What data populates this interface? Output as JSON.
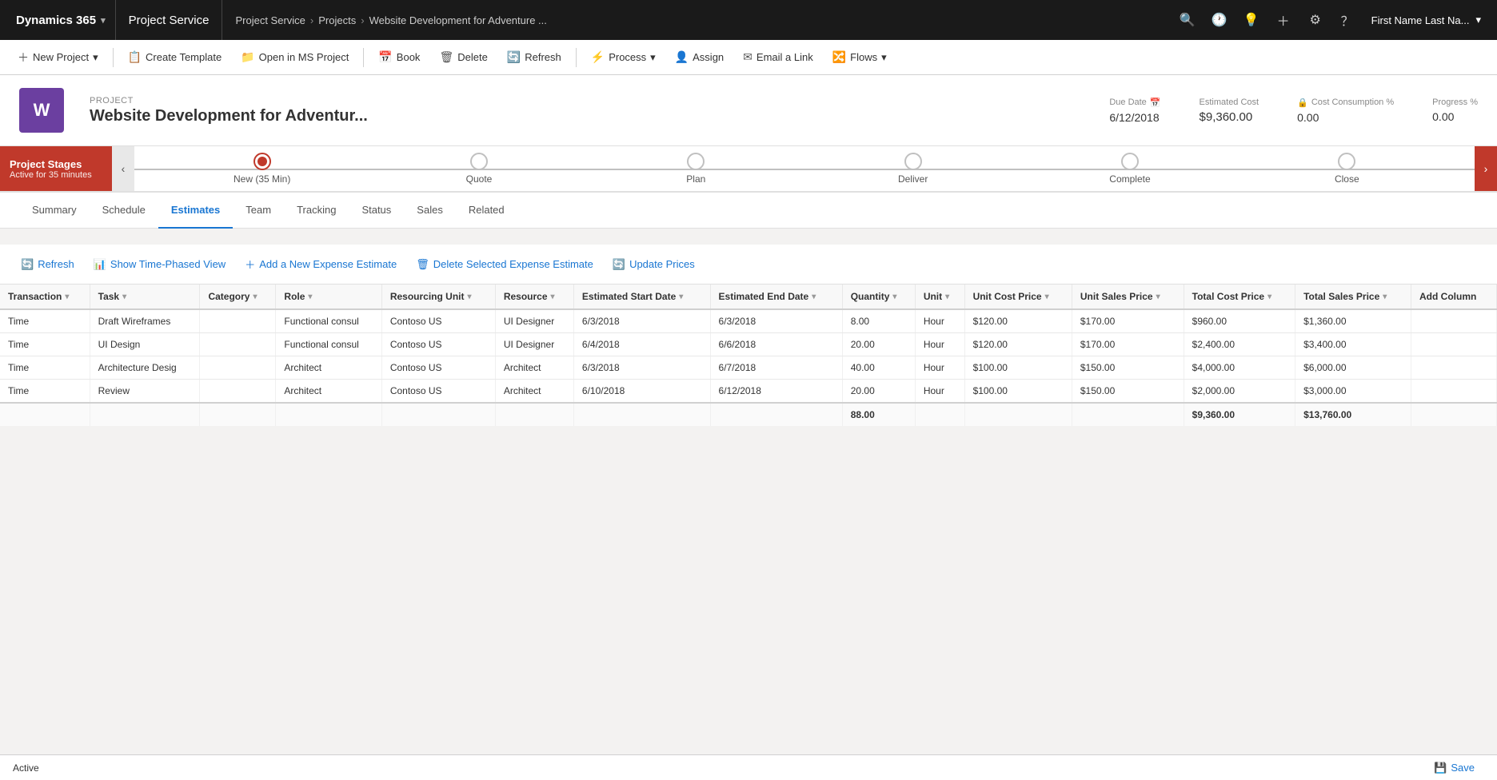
{
  "app": {
    "brand": "Dynamics 365",
    "module": "Project Service",
    "breadcrumb": [
      "Project Service",
      "Projects",
      "Website Development for Adventure ..."
    ]
  },
  "topnav": {
    "icons": [
      "🔍",
      "🕐",
      "💡",
      "＋",
      "⚙",
      "？"
    ],
    "user": "First Name Last Na..."
  },
  "commandbar": {
    "buttons": [
      {
        "id": "new-project",
        "label": "New Project",
        "icon": "＋",
        "has_dropdown": true
      },
      {
        "id": "create-template",
        "label": "Create Template",
        "icon": "📋",
        "has_dropdown": false
      },
      {
        "id": "open-ms-project",
        "label": "Open in MS Project",
        "icon": "📁",
        "has_dropdown": false
      },
      {
        "id": "book",
        "label": "Book",
        "icon": "📅",
        "has_dropdown": false
      },
      {
        "id": "delete",
        "label": "Delete",
        "icon": "🗑",
        "has_dropdown": false
      },
      {
        "id": "refresh",
        "label": "Refresh",
        "icon": "🔄",
        "has_dropdown": false
      },
      {
        "id": "process",
        "label": "Process",
        "icon": "⚡",
        "has_dropdown": true
      },
      {
        "id": "assign",
        "label": "Assign",
        "icon": "👤",
        "has_dropdown": false
      },
      {
        "id": "email-link",
        "label": "Email a Link",
        "icon": "✉",
        "has_dropdown": false
      },
      {
        "id": "flows",
        "label": "Flows",
        "icon": "🔀",
        "has_dropdown": true
      }
    ]
  },
  "project": {
    "label": "PROJECT",
    "title": "Website Development for Adventur...",
    "logo_letter": "W",
    "fields": {
      "due_date_label": "Due Date",
      "due_date_value": "6/12/2018",
      "estimated_cost_label": "Estimated Cost",
      "estimated_cost_value": "$9,360.00",
      "cost_consumption_label": "Cost Consumption %",
      "cost_consumption_value": "0.00",
      "progress_label": "Progress %",
      "progress_value": "0.00"
    }
  },
  "stage_bar": {
    "label": "Project Stages",
    "sublabel": "Active for 35 minutes",
    "stages": [
      {
        "name": "New (35 Min)",
        "active": true
      },
      {
        "name": "Quote",
        "active": false
      },
      {
        "name": "Plan",
        "active": false
      },
      {
        "name": "Deliver",
        "active": false
      },
      {
        "name": "Complete",
        "active": false
      },
      {
        "name": "Close",
        "active": false
      }
    ]
  },
  "tabs": {
    "items": [
      {
        "id": "summary",
        "label": "Summary",
        "active": false
      },
      {
        "id": "schedule",
        "label": "Schedule",
        "active": false
      },
      {
        "id": "estimates",
        "label": "Estimates",
        "active": true
      },
      {
        "id": "team",
        "label": "Team",
        "active": false
      },
      {
        "id": "tracking",
        "label": "Tracking",
        "active": false
      },
      {
        "id": "status",
        "label": "Status",
        "active": false
      },
      {
        "id": "sales",
        "label": "Sales",
        "active": false
      },
      {
        "id": "related",
        "label": "Related",
        "active": false
      }
    ]
  },
  "estimates": {
    "toolbar": {
      "refresh_label": "Refresh",
      "time_phased_label": "Show Time-Phased View",
      "add_expense_label": "Add a New Expense Estimate",
      "delete_expense_label": "Delete Selected Expense Estimate",
      "update_prices_label": "Update Prices"
    },
    "columns": [
      {
        "id": "transaction",
        "label": "Transaction"
      },
      {
        "id": "task",
        "label": "Task"
      },
      {
        "id": "category",
        "label": "Category"
      },
      {
        "id": "role",
        "label": "Role"
      },
      {
        "id": "resourcing_unit",
        "label": "Resourcing Unit"
      },
      {
        "id": "resource",
        "label": "Resource"
      },
      {
        "id": "start_date",
        "label": "Estimated Start Date"
      },
      {
        "id": "end_date",
        "label": "Estimated End Date"
      },
      {
        "id": "quantity",
        "label": "Quantity"
      },
      {
        "id": "unit",
        "label": "Unit"
      },
      {
        "id": "unit_cost_price",
        "label": "Unit Cost Price"
      },
      {
        "id": "unit_sales_price",
        "label": "Unit Sales Price"
      },
      {
        "id": "total_cost_price",
        "label": "Total Cost Price"
      },
      {
        "id": "total_sales_price",
        "label": "Total Sales Price"
      },
      {
        "id": "add_column",
        "label": "Add Column"
      }
    ],
    "rows": [
      {
        "transaction": "Time",
        "task": "Draft Wireframes",
        "category": "",
        "role": "Functional consul",
        "resourcing_unit": "Contoso US",
        "resource": "UI Designer",
        "start_date": "6/3/2018",
        "end_date": "6/3/2018",
        "quantity": "8.00",
        "unit": "Hour",
        "unit_cost_price": "$120.00",
        "unit_sales_price": "$170.00",
        "total_cost_price": "$960.00",
        "total_sales_price": "$1,360.00"
      },
      {
        "transaction": "Time",
        "task": "UI Design",
        "category": "",
        "role": "Functional consul",
        "resourcing_unit": "Contoso US",
        "resource": "UI Designer",
        "start_date": "6/4/2018",
        "end_date": "6/6/2018",
        "quantity": "20.00",
        "unit": "Hour",
        "unit_cost_price": "$120.00",
        "unit_sales_price": "$170.00",
        "total_cost_price": "$2,400.00",
        "total_sales_price": "$3,400.00"
      },
      {
        "transaction": "Time",
        "task": "Architecture Desig",
        "category": "",
        "role": "Architect",
        "resourcing_unit": "Contoso US",
        "resource": "Architect",
        "start_date": "6/3/2018",
        "end_date": "6/7/2018",
        "quantity": "40.00",
        "unit": "Hour",
        "unit_cost_price": "$100.00",
        "unit_sales_price": "$150.00",
        "total_cost_price": "$4,000.00",
        "total_sales_price": "$6,000.00"
      },
      {
        "transaction": "Time",
        "task": "Review",
        "category": "",
        "role": "Architect",
        "resourcing_unit": "Contoso US",
        "resource": "Architect",
        "start_date": "6/10/2018",
        "end_date": "6/12/2018",
        "quantity": "20.00",
        "unit": "Hour",
        "unit_cost_price": "$100.00",
        "unit_sales_price": "$150.00",
        "total_cost_price": "$2,000.00",
        "total_sales_price": "$3,000.00"
      }
    ],
    "footer": {
      "quantity_total": "88.00",
      "total_cost_price": "$9,360.00",
      "total_sales_price": "$13,760.00"
    }
  },
  "statusbar": {
    "status": "Active",
    "save_label": "Save",
    "save_icon": "💾"
  }
}
